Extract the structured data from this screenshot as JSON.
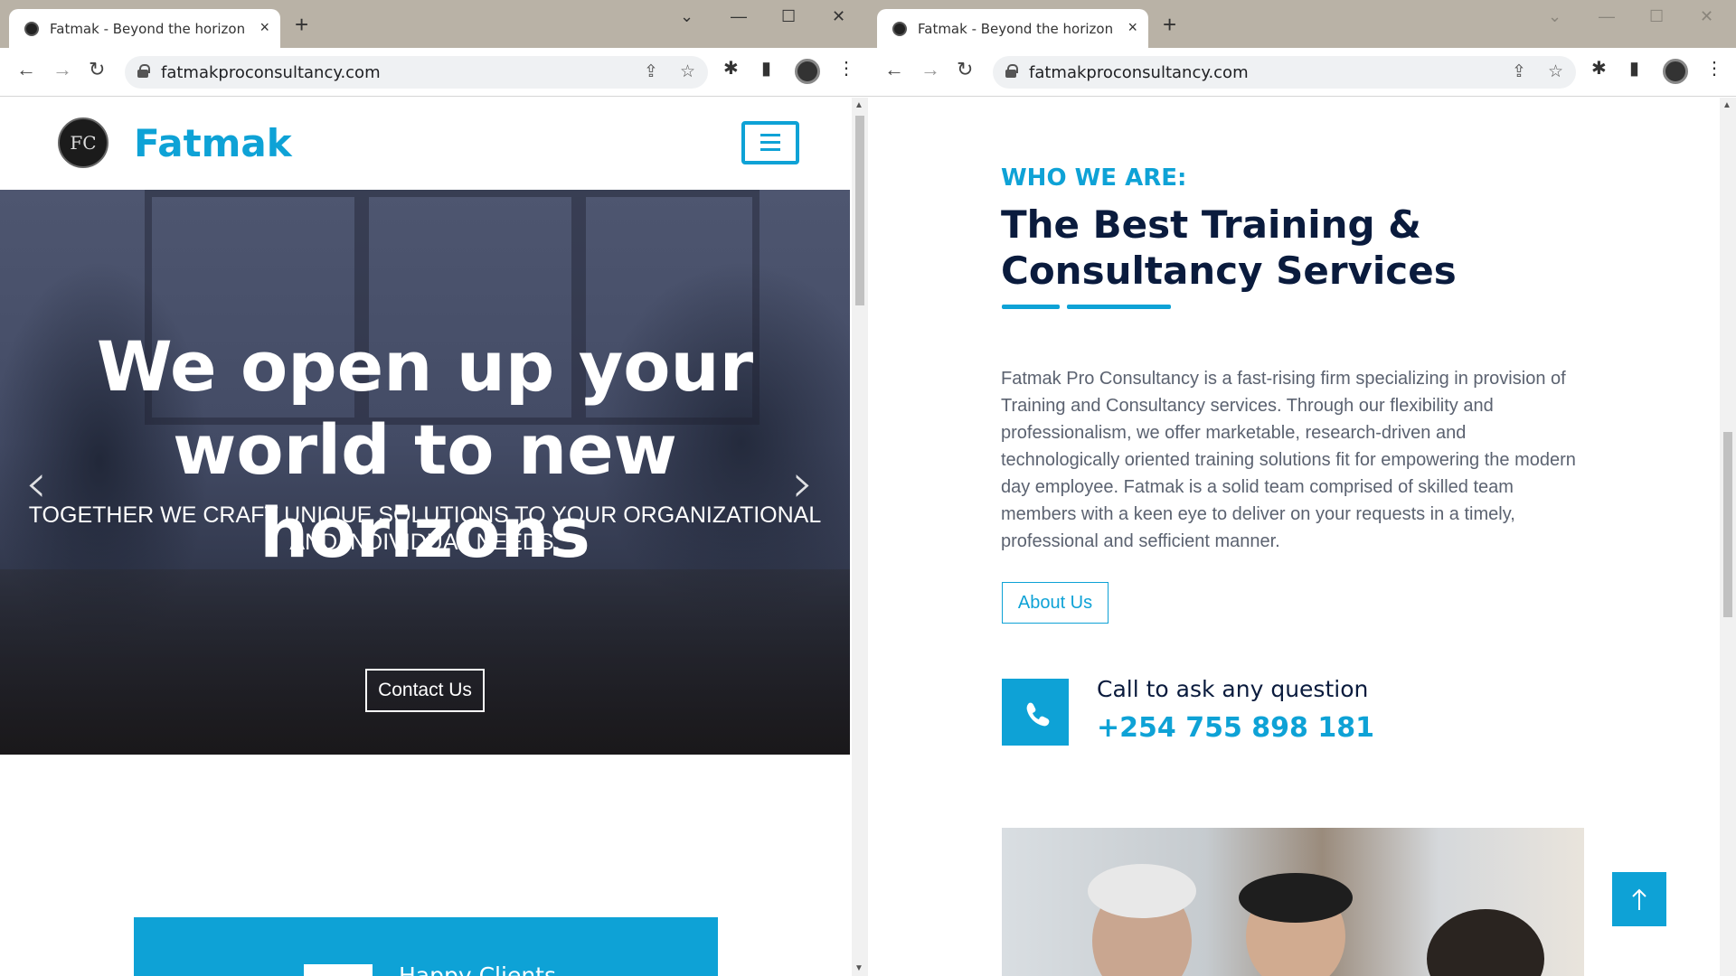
{
  "left_window": {
    "tab_title": "Fatmak - Beyond the horizon",
    "url": "fatmakproconsultancy.com",
    "brand": "Fatmak",
    "logo_initials": "FC",
    "hero": {
      "title": "We open up your world to new horizons",
      "subtitle": "TOGETHER WE CRAFT UNIQUE SOLUTIONS TO YOUR ORGANIZATIONAL AND INDIVIDUAL NEEDS.",
      "cta": "Contact Us"
    },
    "stats": {
      "label": "Happy Clients"
    }
  },
  "right_window": {
    "tab_title": "Fatmak - Beyond the horizon",
    "url": "fatmakproconsultancy.com",
    "kicker": "WHO WE ARE:",
    "title": "The Best Training & Consultancy Services",
    "body": "Fatmak Pro Consultancy is a fast-rising firm specializing in provision of Training and Consultancy services. Through our flexibility and professionalism, we offer marketable, research-driven and technologically oriented training solutions fit for empowering the modern day employee. Fatmak is a solid team comprised of skilled team members with a keen eye to deliver on your requests in a timely, professional and sefficient manner.",
    "about_button": "About Us",
    "call_label": "Call to ask any question",
    "call_number": "+254 755 898 181"
  },
  "icons": {
    "tab_close": "×",
    "new_tab": "+",
    "back": "←",
    "forward": "→",
    "reload": "↻",
    "share": "⇪",
    "star": "☆",
    "extensions": "✱",
    "sidepanel": "▮",
    "menu": "⋮",
    "phone": "✆",
    "up_arrow": "↑",
    "prev": "‹",
    "next": "›"
  },
  "colors": {
    "accent": "#0ea2d6",
    "heading": "#0a1b3d",
    "body_text": "#5b6270",
    "chrome_frame": "#b9b2a6"
  }
}
